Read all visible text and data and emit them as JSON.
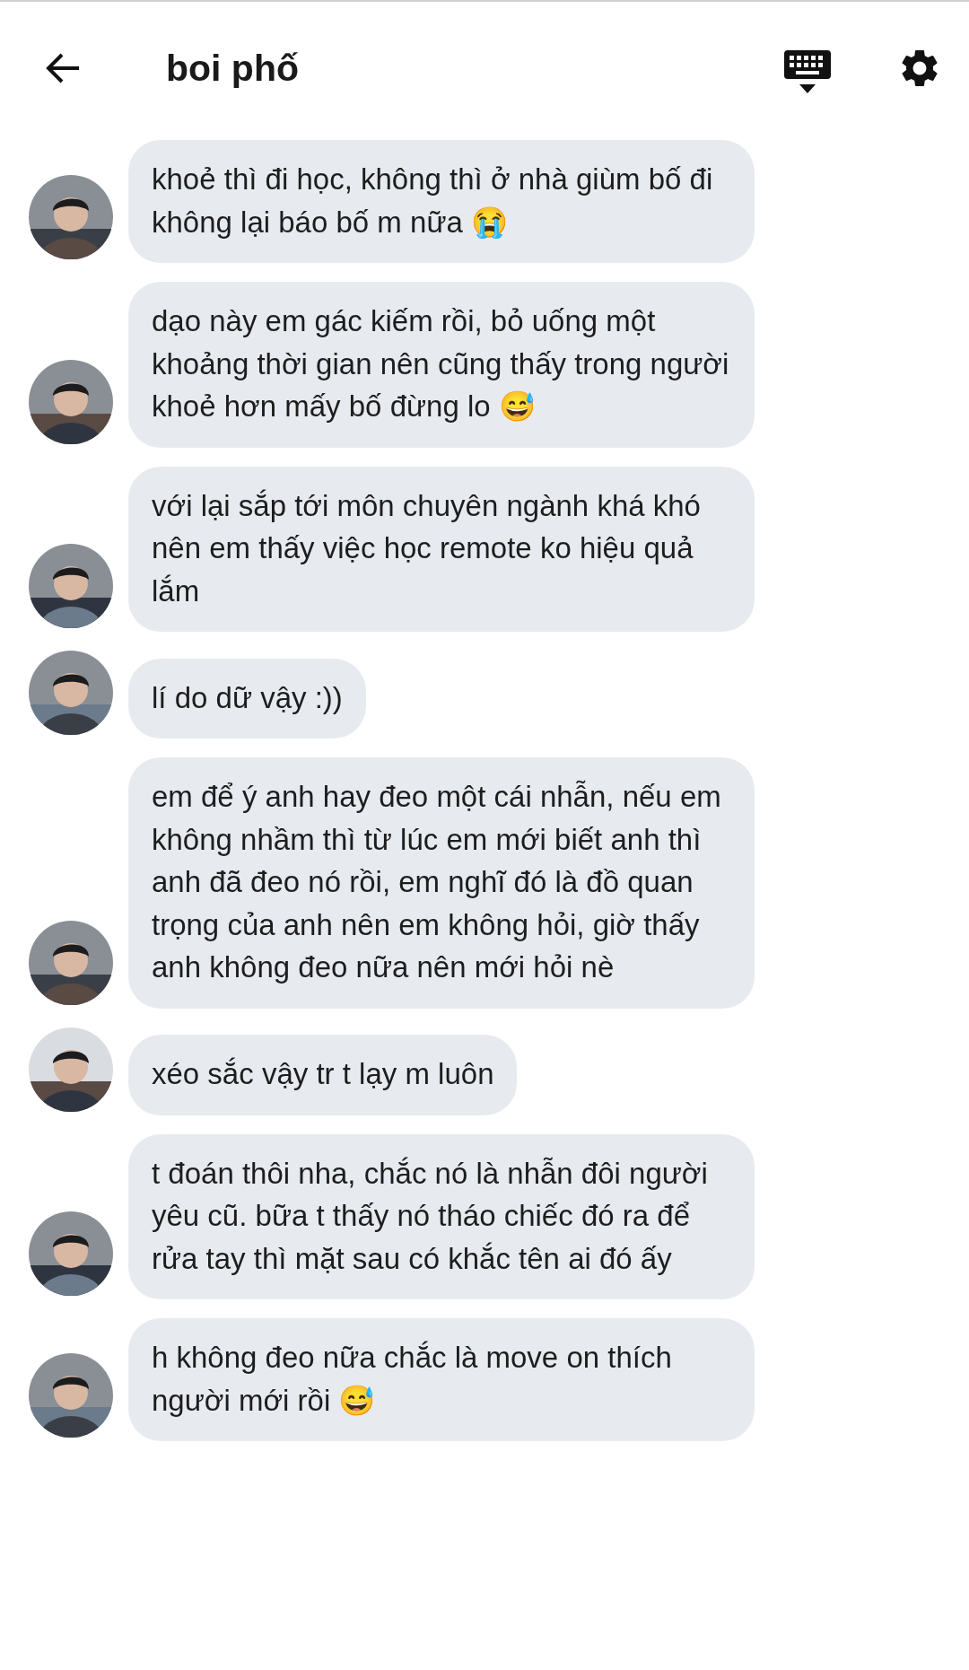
{
  "header": {
    "title": "boi phố"
  },
  "messages": [
    {
      "text": "khoẻ thì đi học, không thì ở nhà giùm bố đi không lại báo bố m nữa 😭"
    },
    {
      "text": "dạo này em gác kiếm rồi, bỏ uống một khoảng thời gian nên cũng thấy trong người khoẻ hơn mấy bố đừng lo 😅"
    },
    {
      "text": "với lại sắp tới môn chuyên ngành khá khó nên em thấy việc học remote ko hiệu quả lắm"
    },
    {
      "text": "lí do dữ vậy :))"
    },
    {
      "text": "em để ý anh hay đeo một cái nhẫn, nếu em không nhầm thì từ lúc em mới biết anh thì anh đã đeo nó rồi, em nghĩ đó là đồ quan trọng của anh nên em không hỏi, giờ thấy anh không đeo nữa nên mới hỏi nè"
    },
    {
      "text": "xéo sắc vậy tr t lạy m luôn"
    },
    {
      "text": "t đoán thôi nha, chắc nó là nhẫn đôi người yêu cũ. bữa t thấy nó tháo chiếc đó ra để rửa tay thì mặt sau có khắc tên ai đó ấy"
    },
    {
      "text": "h không đeo nữa chắc là move on thích người mới rồi 😅"
    }
  ]
}
